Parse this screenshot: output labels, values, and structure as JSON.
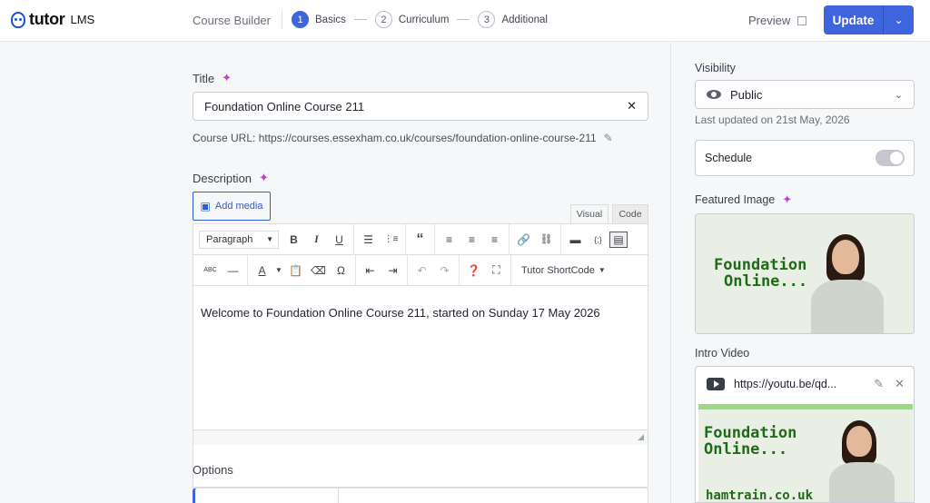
{
  "header": {
    "logo_text": "tutor",
    "logo_sub": "LMS",
    "builder_title": "Course Builder",
    "steps": [
      {
        "num": "1",
        "label": "Basics"
      },
      {
        "num": "2",
        "label": "Curriculum"
      },
      {
        "num": "3",
        "label": "Additional"
      }
    ],
    "preview_label": "Preview",
    "update_label": "Update",
    "caret": "⌄"
  },
  "main": {
    "title_label": "Title",
    "title_value": "Foundation Online Course 211",
    "course_url": "Course URL: https://courses.essexham.co.uk/courses/foundation-online-course-211",
    "description_label": "Description",
    "add_media_label": "Add media",
    "tab_visual": "Visual",
    "tab_code": "Code",
    "paragraph_select": "Paragraph",
    "shortcode_label": "Tutor ShortCode",
    "editor_content": "Welcome to Foundation Online Course 211, started on Sunday 17 May 2026",
    "options_label": "Options"
  },
  "sidebar": {
    "visibility_label": "Visibility",
    "visibility_value": "Public",
    "last_updated": "Last updated on 21st May, 2026",
    "schedule_label": "Schedule",
    "featured_label": "Featured Image",
    "featured_text_1": "Foundation",
    "featured_text_2": "Online...",
    "intro_label": "Intro Video",
    "video_url": "https://youtu.be/qd...",
    "video_text_1": "Foundation",
    "video_text_2": "Online...",
    "video_text_3": "hamtrain.co.uk"
  },
  "colors": {
    "accent": "#3e64de",
    "sparkle": "#c93cce",
    "thumb_green": "#1f6b18"
  }
}
